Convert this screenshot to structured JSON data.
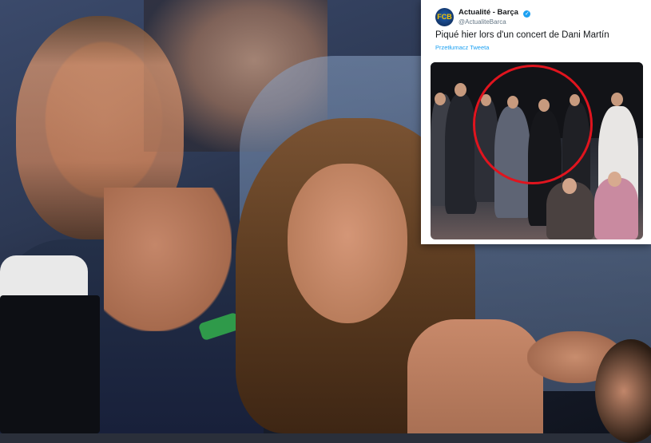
{
  "tweet": {
    "avatar_text": "FCB",
    "display_name": "Actualité - Barça",
    "verified_mark": "✓",
    "handle": "@ActualiteBarca",
    "text": "Piqué hier lors d'un concert de Dani Martín",
    "translate_label": "Przetłumacz Tweeta",
    "image_annotation_color": "#e0141e"
  },
  "colors": {
    "verified": "#1da1f2",
    "wristband": "#2f9a4a"
  }
}
